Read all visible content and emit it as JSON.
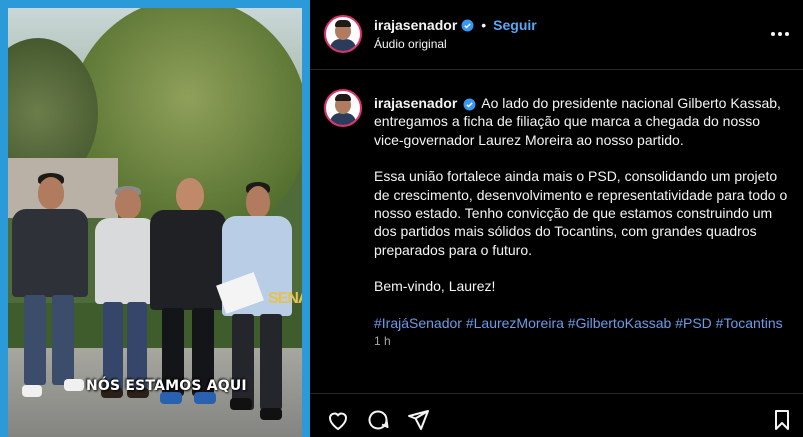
{
  "media": {
    "caption": "NÓS ESTAMOS AQUI",
    "side_banner": "SENA"
  },
  "header": {
    "username": "irajasenador",
    "separator": "•",
    "follow_label": "Seguir",
    "audio": "Áudio original",
    "more_icon": "more-horizontal-icon"
  },
  "post": {
    "username": "irajasenador",
    "paragraphs": [
      "Ao lado do presidente nacional Gilberto Kassab, entregamos a ficha de filiação que marca a chegada do nosso vice-governador Laurez Moreira ao nosso partido.",
      "Essa união fortalece ainda mais o PSD, consolidando um projeto de crescimento, desenvolvimento e representatividade para todo o nosso estado. Tenho convicção de que estamos construindo um dos partidos mais sólidos do Tocantins, com grandes quadros preparados para o futuro.",
      "Bem-vindo, Laurez!"
    ],
    "hashtags": [
      "#IrajáSenador",
      "#LaurezMoreira",
      "#GilbertoKassab",
      "#PSD",
      "#Tocantins"
    ],
    "time": "1 h"
  },
  "actions": {
    "like_icon": "heart-icon",
    "comment_icon": "comment-icon",
    "share_icon": "share-icon",
    "save_icon": "bookmark-icon"
  },
  "colors": {
    "accent_link": "#5aa8f5",
    "hashtag": "#6c9be8",
    "background": "#000000",
    "frame": "#2a9bd8"
  }
}
